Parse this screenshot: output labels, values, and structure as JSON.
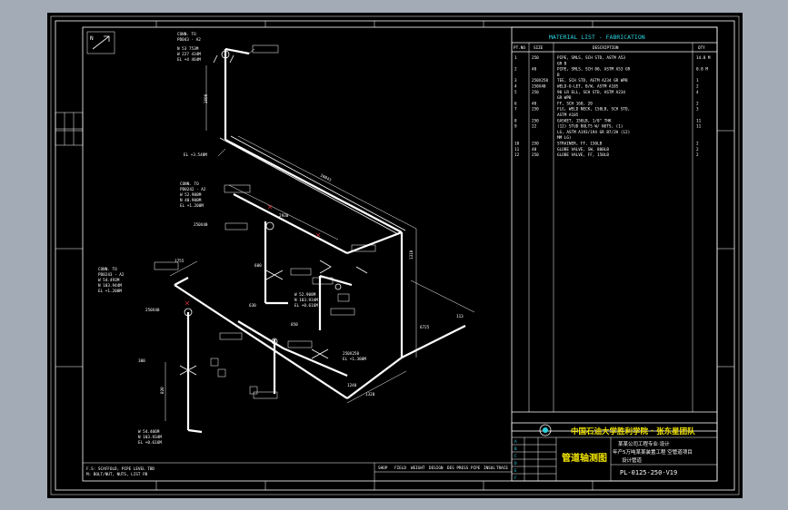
{
  "material_list": {
    "title": "MATERIAL LIST - FABRICATION",
    "headers": {
      "item": "PT.NO",
      "size": "SIZE",
      "description": "DESCRIPTION",
      "qty": "QTY"
    },
    "rows": [
      {
        "item": "1",
        "size": "250",
        "desc": "PIPE, SMLS, SCH STD, ASTM A53",
        "qty": "14.8 M"
      },
      {
        "item": "",
        "size": "",
        "desc": "GR B",
        "qty": ""
      },
      {
        "item": "2",
        "size": "40",
        "desc": "PIPE, SMLS, SCH 80, ASTM A53 GR",
        "qty": "0.8 M"
      },
      {
        "item": "",
        "size": "",
        "desc": "B",
        "qty": ""
      },
      {
        "item": "3",
        "size": "250X250",
        "desc": "TEE, SCH STD, ASTM A234 GR WPB",
        "qty": "1"
      },
      {
        "item": "4",
        "size": "250X40",
        "desc": "WELD-O-LET, B/W, ASTM A105",
        "qty": "2"
      },
      {
        "item": "5",
        "size": "250",
        "desc": "90 LR ELL, SCH STD, ASTM A234",
        "qty": "4"
      },
      {
        "item": "",
        "size": "",
        "desc": "GR WPB",
        "qty": ""
      },
      {
        "item": "6",
        "size": "40",
        "desc": "FF, SCH 160, 20",
        "qty": "2"
      },
      {
        "item": "7",
        "size": "250",
        "desc": "FLG, WELD NECK, 150LB, SCH STD,",
        "qty": "3"
      },
      {
        "item": "",
        "size": "",
        "desc": "ASTM A105",
        "qty": ""
      },
      {
        "item": "8",
        "size": "250",
        "desc": "GASKET, 150LB, 1/8\" THK",
        "qty": "11"
      },
      {
        "item": "9",
        "size": "22",
        "desc": "(12) STUD BOLTS W/ NUTS, (1)",
        "qty": "11"
      },
      {
        "item": "",
        "size": "",
        "desc": "LG, ASTM A193/194 GR B7/2H (12)",
        "qty": ""
      },
      {
        "item": "",
        "size": "",
        "desc": "MM LG)",
        "qty": ""
      },
      {
        "item": "10",
        "size": "250",
        "desc": "STRAINER, FF, 150LB",
        "qty": "2"
      },
      {
        "item": "11",
        "size": "40",
        "desc": "GLOBE VALVE, SW, 800LB",
        "qty": "2"
      },
      {
        "item": "12",
        "size": "250",
        "desc": "GLOBE VALVE, FF, 150LB",
        "qty": "2"
      }
    ]
  },
  "title_block": {
    "school": "中国石油大学胜利学院 · 张东星团队",
    "drawing_title": "管道轴测图",
    "project_line1": "某某公司工程专业·设计",
    "project_line2": "年产5万吨某某装置工程 空管道项目",
    "project_line3": "设计管道",
    "drawing_number": "PL-0125-250-V19",
    "rev_rows": [
      "A",
      "B",
      "C",
      "D",
      "E",
      "F"
    ]
  },
  "notes": {
    "left_1": "F.S: SCAFFOLD, PIPE LEVEL TBD",
    "left_2": "M: BOLT/NUT, NUTS, LIST PB",
    "bottom_columns": [
      "SHOP",
      "FIELD",
      "WEIGHT",
      "DESIGN",
      "DES PRESS",
      "PIPE",
      "INSUL",
      "TRACE"
    ]
  },
  "iso_labels": {
    "north": "N",
    "top_conn": [
      "CONN. TO",
      "PD043 - A2",
      "N 53 753M",
      "W 227 434M",
      "EL +4 464M"
    ],
    "mid_conn": [
      "CONN. TO",
      "PD0242 - A2",
      "W 52.908M",
      "N 40.900M",
      "EL +1.200M"
    ],
    "left_conn": [
      "CONN. TO",
      "PD0243 - A2",
      "W 54.493M",
      "N 103.944M",
      "EL +1.200M"
    ],
    "bottom_coord": [
      "W 54.406M",
      "N 103.934M",
      "EL +0.616M"
    ],
    "mid_coord": [
      "W 52.908M",
      "N 103.934M",
      "EL +0.616M"
    ],
    "right_coord": [
      "250X250",
      "EL +1.300M"
    ],
    "el_upper": "EL +3.548M",
    "dims": [
      "10843",
      "3600",
      "1310",
      "1320",
      "6725",
      "2930",
      "1755",
      "820",
      "630",
      "1240",
      "600",
      "300",
      "113",
      "850"
    ],
    "reducer": "250X40",
    "reducer2": "250X40"
  },
  "colors": {
    "background": "#a3acb6",
    "sheet": "#000000",
    "line": "#ffffff",
    "accent_cyan": "#2ad3e0",
    "title_yellow": "#f2e500"
  }
}
